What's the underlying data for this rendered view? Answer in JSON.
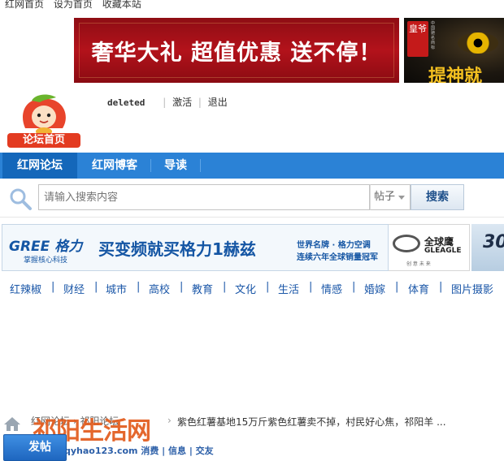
{
  "topbar": {
    "links": [
      "红网首页",
      "设为首页",
      "收藏本站"
    ]
  },
  "banner_main": {
    "text": "奢华大礼  超值优惠  送不停！"
  },
  "banner_side": {
    "seal_text": "皇爷",
    "seal_small": "中国驰名商标",
    "text": "提神就"
  },
  "logo": {
    "label": "论坛首页"
  },
  "userbar": {
    "username": "deleted",
    "activate": "激活",
    "logout": "退出"
  },
  "nav": {
    "items": [
      {
        "label": "红网论坛",
        "active": true
      },
      {
        "label": "红网博客",
        "active": false
      },
      {
        "label": "导读",
        "active": false
      }
    ],
    "color": "#2b82d6",
    "active_color": "#1467ba"
  },
  "search": {
    "placeholder": "请输入搜索内容",
    "type_value": "帖子",
    "button": "搜索"
  },
  "ad_gree": {
    "logo": "GREE 格力",
    "sub": "掌握核心科技",
    "main": "买变频就买格力1赫兹",
    "slogan1": "世界名牌 · 格力空调",
    "slogan2": "连续六年全球销量冠军"
  },
  "ad_gleagle": {
    "cn": "全球鹰",
    "en": "GLEAGLE",
    "sub": "创 意 未 来"
  },
  "ad_30": {
    "text": "30"
  },
  "channels": [
    "红辣椒",
    "财经",
    "城市",
    "高校",
    "教育",
    "文化",
    "生活",
    "情感",
    "婚嫁",
    "体育",
    "图片摄影"
  ],
  "breadcrumb": {
    "hidden": "红网论坛  ›  祁阳论坛",
    "separator": "›",
    "title": "紫色红薯基地15万斤紫色红薯卖不掉，村民好心焦，祁阳羊 ..."
  },
  "watermark": {
    "main": "祁阳生活网",
    "sub": "www.qyhao123.com 消费 | 信息 | 交友"
  },
  "post_button": {
    "label": "发帖"
  }
}
